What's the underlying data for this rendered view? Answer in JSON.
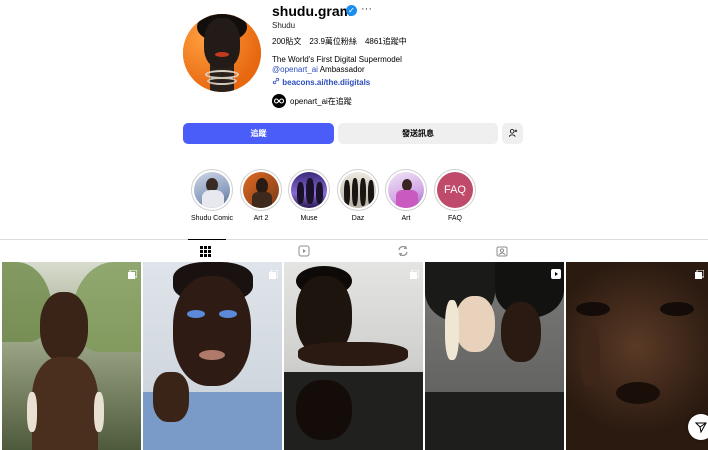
{
  "profile": {
    "username": "shudu.gram",
    "more": "···",
    "full_name": "Shudu",
    "posts": "200貼文",
    "followers": "23.9萬位粉絲",
    "following": "4861追蹤中",
    "bio_line1": "The World's First Digital Supermodel",
    "bio_mention": "@openart_ai",
    "bio_line2_suffix": " Ambassador",
    "link": "beacons.ai/the.diigitals",
    "followed_by": "openart_ai在追蹤"
  },
  "actions": {
    "follow": "追蹤",
    "message": "發送訊息",
    "add_user_icon": "+"
  },
  "highlights": [
    {
      "label": "Shudu Comic"
    },
    {
      "label": "Art 2"
    },
    {
      "label": "Muse"
    },
    {
      "label": "Daz"
    },
    {
      "label": "Art"
    },
    {
      "label": "FAQ",
      "cover_text": "FAQ"
    }
  ],
  "tabs": [
    {
      "icon": "grid-icon",
      "active": true
    },
    {
      "icon": "reels-icon",
      "active": false
    },
    {
      "icon": "repost-icon",
      "active": false
    },
    {
      "icon": "tagged-icon",
      "active": false
    }
  ],
  "grid": [
    {
      "type": "carousel"
    },
    {
      "type": "carousel"
    },
    {
      "type": "carousel"
    },
    {
      "type": "reel"
    },
    {
      "type": "carousel"
    }
  ],
  "colors": {
    "accent": "#4a5df9",
    "verified": "#1c8ef0",
    "link": "#2b4dbd",
    "faq_cover": "#c04a6a"
  }
}
